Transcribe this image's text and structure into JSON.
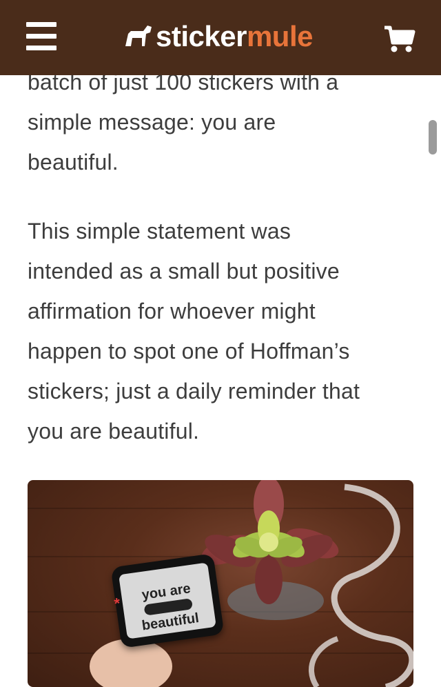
{
  "header": {
    "logo_part1": "sticker",
    "logo_part2": "mule",
    "menu_icon": "hamburger-menu-icon",
    "cart_icon": "shopping-cart-icon",
    "background_color": "#4a2c1a",
    "accent_color": "#e8743a"
  },
  "article": {
    "paragraph1_lines": [
      "batch of just 100 stickers with a",
      "simple message: you are",
      "beautiful."
    ],
    "paragraph2_lines": [
      "This simple statement was",
      "intended as a small but positive",
      "affirmation for whoever might",
      "happen to spot one of Hoffman’s",
      "stickers; just a daily reminder that",
      "you are beautiful."
    ]
  },
  "hero_image": {
    "sticker_line1": "you are",
    "sticker_line2": "beautiful"
  }
}
